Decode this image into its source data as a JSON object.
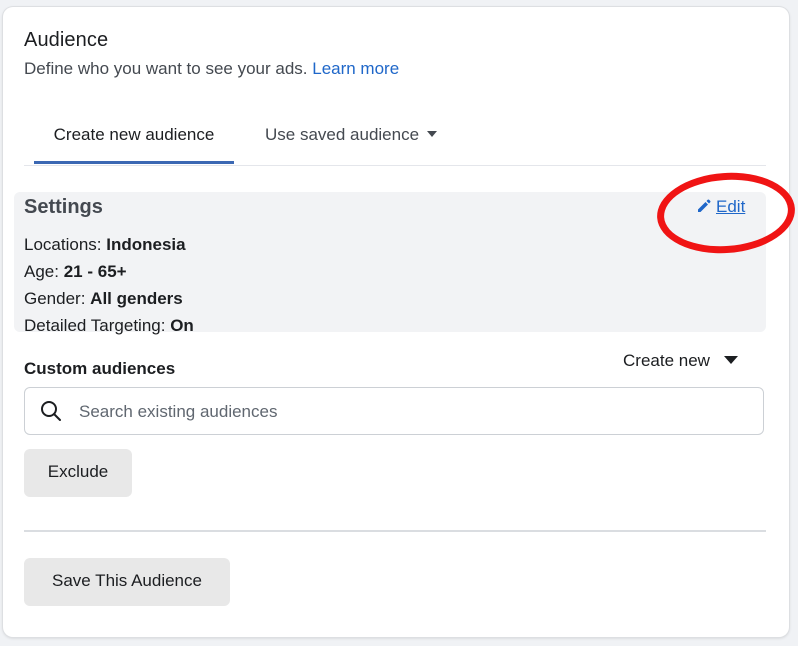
{
  "header": {
    "title": "Audience",
    "subtitle": "Define who you want to see your ads.",
    "learn_more": "Learn more"
  },
  "tabs": [
    {
      "label": "Create new audience",
      "active": true
    },
    {
      "label": "Use saved audience",
      "active": false
    }
  ],
  "settings": {
    "title": "Settings",
    "edit_label": "Edit",
    "rows": [
      {
        "label": "Locations:",
        "value": "Indonesia"
      },
      {
        "label": "Age:",
        "value": "21 - 65+"
      },
      {
        "label": "Gender:",
        "value": "All genders"
      },
      {
        "label": "Detailed Targeting:",
        "value": "On"
      }
    ]
  },
  "custom_audiences": {
    "label": "Custom audiences",
    "create_new": "Create new",
    "search_placeholder": "Search existing audiences",
    "search_value": "",
    "exclude_label": "Exclude"
  },
  "footer": {
    "save_label": "Save This Audience"
  },
  "icons": {
    "edit": "pencil-icon",
    "search": "search-icon",
    "dropdown": "caret-down-icon"
  },
  "colors": {
    "link": "#1f67c9",
    "tab_underline": "#3b68b3",
    "highlight_circle": "#f01414",
    "settings_bg": "#f2f3f5"
  }
}
